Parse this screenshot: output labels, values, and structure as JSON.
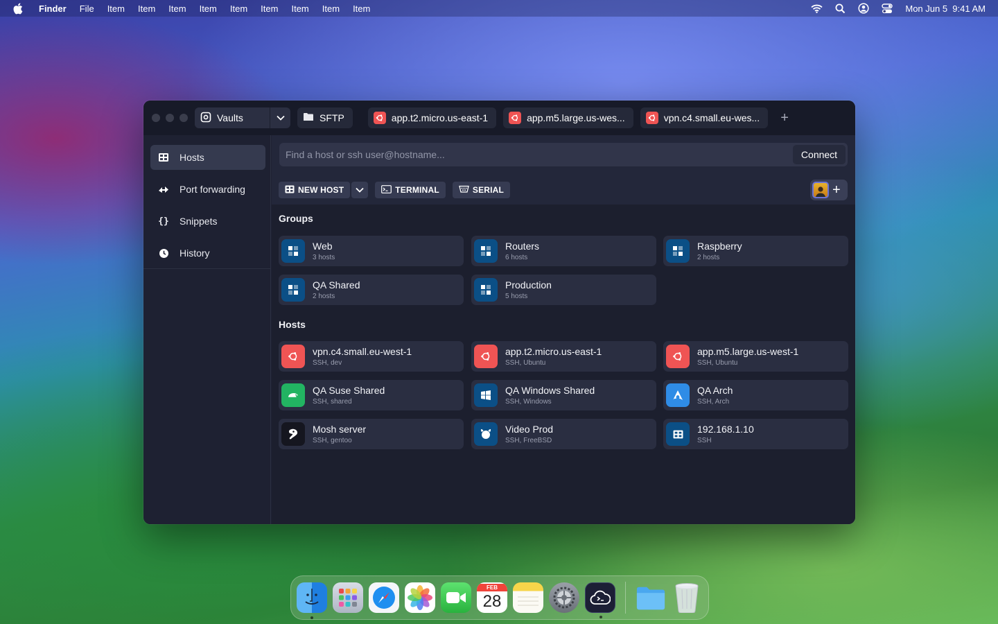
{
  "menubar": {
    "app_name": "Finder",
    "items": [
      "File",
      "Item",
      "Item",
      "Item",
      "Item",
      "Item",
      "Item",
      "Item",
      "Item",
      "Item"
    ],
    "datetime": "Mon Jun 5  9:41 AM",
    "status_icons": [
      "wifi-icon",
      "search-icon",
      "user-icon",
      "control-center-icon"
    ]
  },
  "titlebar": {
    "vaults_label": "Vaults",
    "tabs": [
      {
        "label": "SFTP",
        "icon": "folder-icon"
      },
      {
        "label": "app.t2.micro.us-east-1",
        "icon": "ubuntu-icon",
        "color": "#ef5454"
      },
      {
        "label": "app.m5.large.us-wes...",
        "icon": "ubuntu-icon",
        "color": "#ef5454"
      },
      {
        "label": "vpn.c4.small.eu-wes...",
        "icon": "ubuntu-icon",
        "color": "#ef5454"
      }
    ],
    "add_tab": "+"
  },
  "sidebar": {
    "items": [
      {
        "label": "Hosts",
        "icon": "hosts-icon",
        "active": true
      },
      {
        "label": "Port forwarding",
        "icon": "port-forwarding-icon"
      },
      {
        "label": "Snippets",
        "icon": "snippets-icon"
      },
      {
        "label": "History",
        "icon": "history-icon"
      }
    ]
  },
  "search": {
    "placeholder": "Find a host or ssh user@hostname...",
    "connect_label": "Connect"
  },
  "toolbar": {
    "new_host": "NEW HOST",
    "terminal": "TERMINAL",
    "serial": "SERIAL"
  },
  "groups_title": "Groups",
  "groups": [
    {
      "name": "Web",
      "sub": "3 hosts"
    },
    {
      "name": "Routers",
      "sub": "6 hosts"
    },
    {
      "name": "Raspberry",
      "sub": "2 hosts"
    },
    {
      "name": "QA Shared",
      "sub": "2 hosts"
    },
    {
      "name": "Production",
      "sub": "5 hosts"
    }
  ],
  "hosts_title": "Hosts",
  "hosts": [
    {
      "name": "vpn.c4.small.eu-west-1",
      "sub": "SSH, dev",
      "icon": "ubuntu-icon",
      "color": "#ef5454"
    },
    {
      "name": "app.t2.micro.us-east-1",
      "sub": "SSH, Ubuntu",
      "icon": "ubuntu-icon",
      "color": "#ef5454"
    },
    {
      "name": "app.m5.large.us-west-1",
      "sub": "SSH, Ubuntu",
      "icon": "ubuntu-icon",
      "color": "#ef5454"
    },
    {
      "name": "QA Suse Shared",
      "sub": "SSH, shared",
      "icon": "suse-icon",
      "color": "#22b462"
    },
    {
      "name": "QA Windows Shared",
      "sub": "SSH, Windows",
      "icon": "windows-icon",
      "color": "#0b4f86"
    },
    {
      "name": "QA Arch",
      "sub": "SSH, Arch",
      "icon": "arch-icon",
      "color": "#2f8ce6"
    },
    {
      "name": "Mosh server",
      "sub": "SSH, gentoo",
      "icon": "gentoo-icon",
      "color": "#15161f"
    },
    {
      "name": "Video Prod",
      "sub": "SSH, FreeBSD",
      "icon": "freebsd-icon",
      "color": "#0b4f86"
    },
    {
      "name": "192.168.1.10",
      "sub": "SSH",
      "icon": "server-icon",
      "color": "#0b4f86"
    }
  ],
  "dock": {
    "apps": [
      "finder-icon",
      "launchpad-icon",
      "safari-icon",
      "photos-icon",
      "facetime-icon",
      "calendar-icon",
      "notes-icon",
      "settings-icon",
      "termius-icon",
      "folder-icon",
      "trash-icon"
    ],
    "calendar_month": "FEB",
    "calendar_day": "28"
  },
  "colors": {
    "window_bg": "#1e2132",
    "accent_red": "#ef5454",
    "group_icon_bg": "#0b4f86"
  }
}
